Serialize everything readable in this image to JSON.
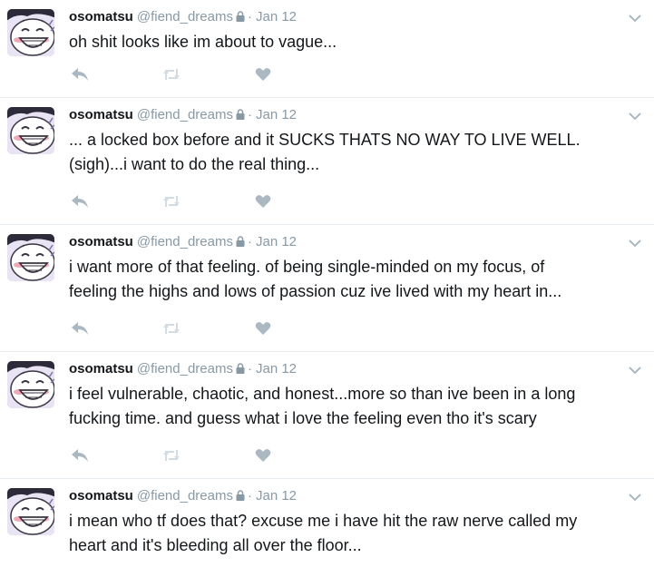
{
  "tweets": [
    {
      "name": "osomatsu",
      "handle": "@fiend_dreams",
      "time": "Jan 12",
      "text": "oh shit looks like im about to vague..."
    },
    {
      "name": "osomatsu",
      "handle": "@fiend_dreams",
      "time": "Jan 12",
      "text": "... a locked box before and it SUCKS THATS NO WAY TO LIVE WELL.\n(sigh)...i want to do the real thing..."
    },
    {
      "name": "osomatsu",
      "handle": "@fiend_dreams",
      "time": "Jan 12",
      "text": "i want more of that feeling. of being single-minded on my focus, of\nfeeling the highs and lows of passion cuz ive lived with my heart in..."
    },
    {
      "name": "osomatsu",
      "handle": "@fiend_dreams",
      "time": "Jan 12",
      "text": "i feel vulnerable, chaotic, and honest...more so than ive been in a long\nfucking time. and guess what i love the feeling even tho it's scary"
    },
    {
      "name": "osomatsu",
      "handle": "@fiend_dreams",
      "time": "Jan 12",
      "text": "i mean who tf does that? excuse me i have hit the raw nerve called my\nheart and it's bleeding all over the floor..."
    }
  ],
  "separator": "·",
  "icons": {
    "avatar": "cartoon-avatar",
    "lock": "lock-icon",
    "caret": "chevron-down-icon",
    "reply": "reply-icon",
    "retweet": "retweet-icon",
    "like": "heart-icon"
  },
  "colors": {
    "text": "#14171a",
    "muted": "#8899a6",
    "icon": "#aab8c2",
    "divider": "#e6ecf0"
  }
}
